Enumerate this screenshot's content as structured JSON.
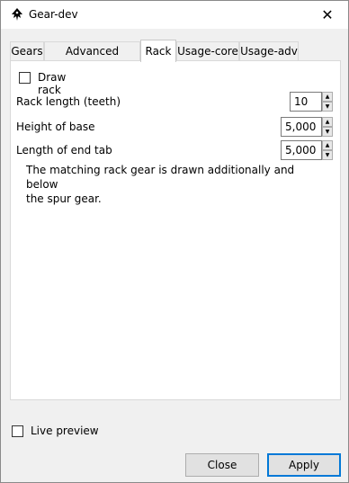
{
  "window": {
    "title": "Gear-dev"
  },
  "tabs": [
    "Gears",
    "Advanced options",
    "Rack",
    "Usage-core",
    "Usage-adv"
  ],
  "rack": {
    "draw_rack_label": "Draw rack",
    "draw_rack_checked": false,
    "rack_length_label": "Rack length (teeth)",
    "rack_length_value": "10",
    "height_base_label": "Height of base",
    "height_base_value": "5,000",
    "end_tab_label": "Length of end tab",
    "end_tab_value": "5,000",
    "note_line1": "The matching rack gear is drawn additionally and below",
    "note_line2": "the spur gear."
  },
  "footer": {
    "live_preview_label": "Live preview",
    "live_preview_checked": false,
    "close_label": "Close",
    "apply_label": "Apply"
  }
}
